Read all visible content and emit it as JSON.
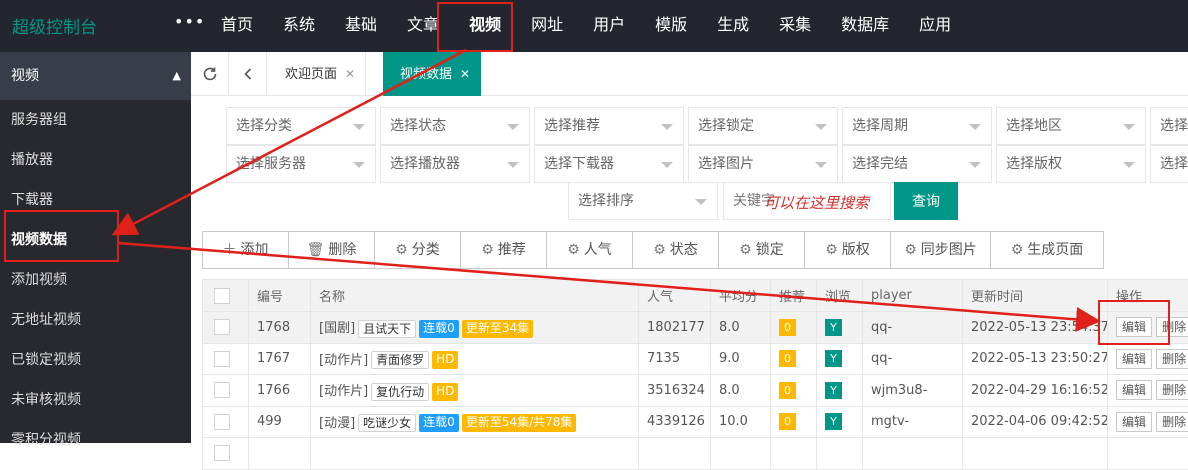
{
  "brand": "超级控制台",
  "dots": "•••",
  "top_nav": [
    "首页",
    "系统",
    "基础",
    "文章",
    "视频",
    "网址",
    "用户",
    "模版",
    "生成",
    "采集",
    "数据库",
    "应用"
  ],
  "sidebar": {
    "header": "视频",
    "items": [
      "服务器组",
      "播放器",
      "下载器",
      "视频数据",
      "添加视频",
      "无地址视频",
      "已锁定视频",
      "未审核视频",
      "零积分视频"
    ]
  },
  "tabs": [
    {
      "label": "欢迎页面"
    },
    {
      "label": "视频数据"
    }
  ],
  "filters": {
    "row1": [
      "选择分类",
      "选择状态",
      "选择推荐",
      "选择锁定",
      "选择周期",
      "选择地区",
      "选择"
    ],
    "row2": [
      "选择服务器",
      "选择播放器",
      "选择下载器",
      "选择图片",
      "选择完结",
      "选择版权",
      "选择"
    ],
    "sort": "选择排序",
    "keyword_placeholder": "关键字",
    "query_label": "查询",
    "note": "可以在这里搜索"
  },
  "toolbar": [
    {
      "icon": "plus-icon",
      "label": "添加"
    },
    {
      "icon": "trash-icon",
      "label": "删除"
    },
    {
      "icon": "gear-icon",
      "label": "分类"
    },
    {
      "icon": "gear-icon",
      "label": "推荐"
    },
    {
      "icon": "gear-icon",
      "label": "人气"
    },
    {
      "icon": "gear-icon",
      "label": "状态"
    },
    {
      "icon": "gear-icon",
      "label": "锁定"
    },
    {
      "icon": "gear-icon",
      "label": "版权"
    },
    {
      "icon": "gear-icon",
      "label": "同步图片"
    },
    {
      "icon": "gear-icon",
      "label": "生成页面"
    }
  ],
  "table": {
    "headers": [
      "",
      "编号",
      "名称",
      "人气",
      "平均分",
      "推荐",
      "浏览",
      "player",
      "更新时间",
      "操作"
    ],
    "rows": [
      {
        "id": "1768",
        "cat": "[国剧]",
        "name": "且试天下",
        "tags": [
          {
            "text": "连载0",
            "style": "blue"
          },
          {
            "text": "更新至34集",
            "style": "orange"
          }
        ],
        "hits": "1802177",
        "score": "8.0",
        "rec": "0",
        "view": "Y",
        "player": "qq-",
        "time": "2022-05-13 23:54:37",
        "time_red": true,
        "edit": "编辑",
        "del": "删除"
      },
      {
        "id": "1767",
        "cat": "[动作片]",
        "name": "青面修罗",
        "tags": [
          {
            "text": "HD",
            "style": "orange"
          }
        ],
        "hits": "7135",
        "score": "9.0",
        "rec": "0",
        "view": "Y",
        "player": "qq-",
        "time": "2022-05-13 23:50:27",
        "time_red": true,
        "edit": "编辑",
        "del": "删除"
      },
      {
        "id": "1766",
        "cat": "[动作片]",
        "name": "复仇行动",
        "tags": [
          {
            "text": "HD",
            "style": "orange"
          }
        ],
        "hits": "3516324",
        "score": "8.0",
        "rec": "0",
        "view": "Y",
        "player": "wjm3u8-",
        "time": "2022-04-29 16:16:52",
        "time_red": false,
        "edit": "编辑",
        "del": "删除"
      },
      {
        "id": "499",
        "cat": "[动漫]",
        "name": "吃谜少女",
        "tags": [
          {
            "text": "连载0",
            "style": "blue"
          },
          {
            "text": "更新至54集/共78集",
            "style": "orange"
          }
        ],
        "hits": "4339126",
        "score": "10.0",
        "rec": "0",
        "view": "Y",
        "player": "mgtv-",
        "time": "2022-04-06 09:42:52",
        "time_red": false,
        "edit": "编辑",
        "del": "删除"
      },
      {
        "id": "",
        "cat": "",
        "name": "",
        "tags": [],
        "hits": "",
        "score": "",
        "rec": "",
        "view": "",
        "player": "",
        "time": "",
        "time_red": false,
        "edit": "",
        "del": ""
      }
    ]
  },
  "colors": {
    "accent": "#009688",
    "annotation": "#e0201b",
    "dark": "#23262e"
  }
}
